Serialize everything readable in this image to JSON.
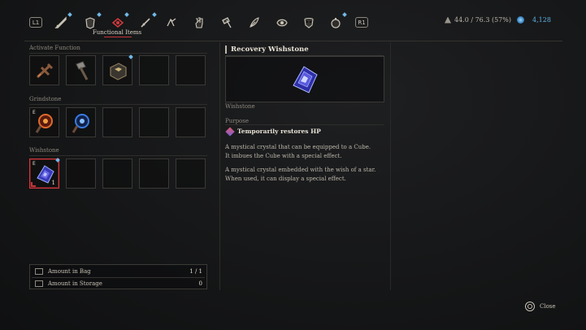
{
  "topbar": {
    "left_button": "L1",
    "right_button": "R1",
    "selected_category": "Functional Items",
    "categories": [
      {
        "icon": "sword-icon",
        "new": true
      },
      {
        "icon": "armor-icon",
        "new": true
      },
      {
        "icon": "functional-items-icon",
        "new": true,
        "selected": true
      },
      {
        "icon": "dagger-icon",
        "new": true
      },
      {
        "icon": "legion-arm-icon",
        "new": false
      },
      {
        "icon": "gauntlet-icon",
        "new": false
      },
      {
        "icon": "hammer-icon",
        "new": false
      },
      {
        "icon": "feather-icon",
        "new": false
      },
      {
        "icon": "amulet-icon",
        "new": false
      },
      {
        "icon": "mask-icon",
        "new": false
      },
      {
        "icon": "consumable-icon",
        "new": true
      }
    ],
    "weight": "44.0 / 76.3 (57%)",
    "ergo": "4,128"
  },
  "sections": {
    "activate_function": {
      "label": "Activate Function",
      "slots": [
        {
          "icon": "fuse-crossbow-icon"
        },
        {
          "icon": "hammer-tool-icon"
        },
        {
          "icon": "cube-box-icon",
          "new": true
        },
        {},
        {}
      ]
    },
    "grindstone": {
      "label": "Grindstone",
      "slots": [
        {
          "icon": "fire-grindstone-icon",
          "equipped": "E"
        },
        {
          "icon": "electric-grindstone-icon"
        },
        {},
        {},
        {}
      ]
    },
    "wishstone": {
      "label": "Wishstone",
      "slots": [
        {
          "icon": "recovery-wishstone-icon",
          "equipped": "E",
          "count": "1",
          "new": true,
          "selected": true
        },
        {},
        {},
        {},
        {}
      ]
    }
  },
  "amounts": {
    "bag_label": "Amount in Bag",
    "bag_value": "1 / 1",
    "storage_label": "Amount in Storage",
    "storage_value": "0"
  },
  "detail": {
    "title": "Recovery Wishstone",
    "category": "Wishstone",
    "purpose_label": "Purpose",
    "purpose": "Temporarily restores HP",
    "desc1_line1": "A mystical crystal that can be equipped to a Cube.",
    "desc1_line2": "It imbues the Cube with a special effect.",
    "desc2_line1": "A mystical crystal embedded with the wish of a star.",
    "desc2_line2": "When used, it can display a special effect."
  },
  "footer": {
    "close_label": "Close"
  },
  "colors": {
    "accent_red": "#d23a3f",
    "new_marker": "#6fb8e8",
    "ergo_blue": "#5eaee0"
  }
}
